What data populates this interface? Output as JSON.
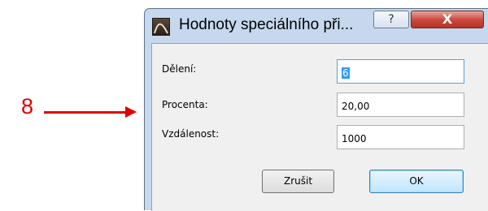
{
  "annotation": {
    "number": "8"
  },
  "window": {
    "title": "Hodnoty speciálního při...",
    "help_label": "?",
    "close_label": "X"
  },
  "fields": [
    {
      "label": "Dělení:",
      "value": "6"
    },
    {
      "label": "Procenta:",
      "value": "20,00"
    },
    {
      "label": "Vzdálenost:",
      "value": "1000"
    }
  ],
  "buttons": {
    "cancel": "Zrušit",
    "ok": "OK"
  },
  "colors": {
    "annotation": "#e00000",
    "frame": "#c6d8ee",
    "client": "#f0f0f0",
    "close": "#c7453a",
    "selection": "#3399ff"
  }
}
